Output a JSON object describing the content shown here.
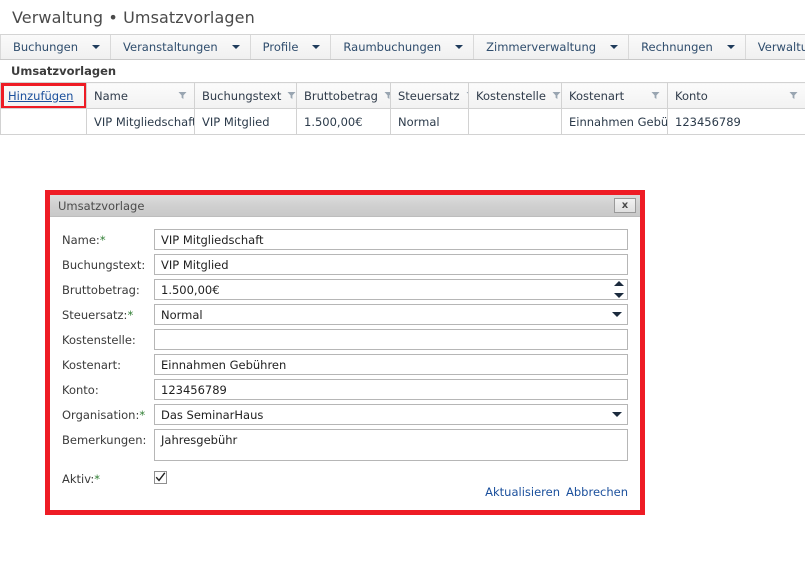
{
  "header": {
    "title": "Verwaltung • Umsatzvorlagen"
  },
  "menubar": {
    "items": [
      {
        "label": "Buchungen",
        "icon": "chevron-down-icon"
      },
      {
        "label": "Veranstaltungen",
        "icon": "chevron-down-icon"
      },
      {
        "label": "Profile",
        "icon": "chevron-down-icon"
      },
      {
        "label": "Raumbuchungen",
        "icon": "chevron-down-icon"
      },
      {
        "label": "Zimmerverwaltung",
        "icon": "chevron-down-icon"
      },
      {
        "label": "Rechnungen",
        "icon": "chevron-down-icon"
      },
      {
        "label": "Verwaltung",
        "icon": "chevron-down-icon"
      }
    ]
  },
  "section": {
    "caption": "Umsatzvorlagen"
  },
  "grid": {
    "add_label": "Hinzufügen",
    "filter_icon": "filter-icon",
    "columns": [
      "Name",
      "Buchungstext",
      "Bruttobetrag",
      "Steuersatz",
      "Kostenstelle",
      "Kostenart",
      "Konto"
    ],
    "rows": [
      {
        "name": "VIP Mitgliedschaft",
        "buchungstext": "VIP Mitglied",
        "bruttobetrag": "1.500,00€",
        "steuersatz": "Normal",
        "kostenstelle": "",
        "kostenart": "Einnahmen Gebühren",
        "konto": "123456789"
      }
    ]
  },
  "dialog": {
    "title": "Umsatzvorlage",
    "close_label": "x",
    "fields": {
      "name": {
        "label": "Name:",
        "required": "*",
        "value": "VIP Mitgliedschaft"
      },
      "buchungstext": {
        "label": "Buchungstext:",
        "required": "",
        "value": "VIP Mitglied"
      },
      "bruttobetrag": {
        "label": "Bruttobetrag:",
        "required": "",
        "value": "1.500,00€"
      },
      "steuersatz": {
        "label": "Steuersatz:",
        "required": "*",
        "value": "Normal"
      },
      "kostenstelle": {
        "label": "Kostenstelle:",
        "required": "",
        "value": ""
      },
      "kostenart": {
        "label": "Kostenart:",
        "required": "",
        "value": "Einnahmen Gebühren"
      },
      "konto": {
        "label": "Konto:",
        "required": "",
        "value": "123456789"
      },
      "organisation": {
        "label": "Organisation:",
        "required": "*",
        "value": "Das SeminarHaus"
      },
      "bemerkungen": {
        "label": "Bemerkungen:",
        "required": "",
        "value": "Jahresgebühr"
      },
      "aktiv": {
        "label": "Aktiv:",
        "required": "*",
        "checked": true
      }
    },
    "actions": {
      "update_label": "Aktualisieren",
      "cancel_label": "Abbrechen"
    }
  },
  "colors": {
    "annotation": "#ee1c25",
    "link": "#1a4f9c",
    "required": "#2e7d32"
  }
}
